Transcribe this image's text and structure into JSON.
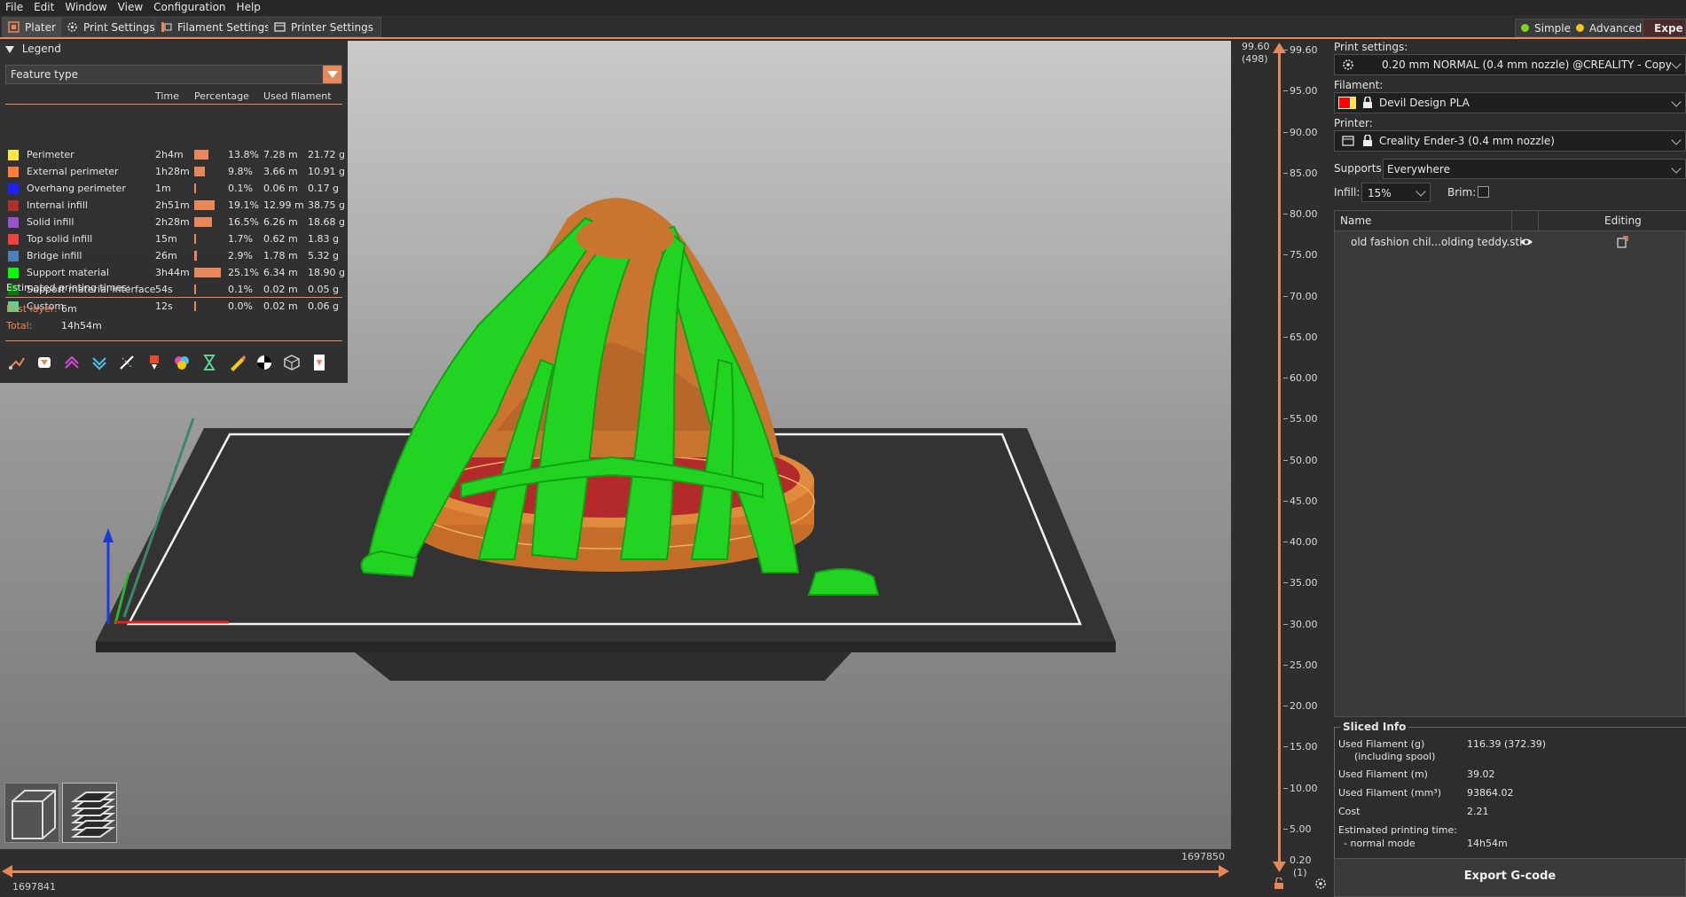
{
  "menu": [
    "File",
    "Edit",
    "Window",
    "View",
    "Configuration",
    "Help"
  ],
  "tabs": [
    "Plater",
    "Print Settings",
    "Filament Settings",
    "Printer Settings"
  ],
  "modes": [
    {
      "label": "Simple",
      "color": "#7ed321"
    },
    {
      "label": "Advanced",
      "color": "#f5c518"
    },
    {
      "label": "Expe",
      "color": "#d0021b"
    }
  ],
  "legend": {
    "title": "Legend",
    "feature_type": "Feature type",
    "columns": {
      "time": "Time",
      "percentage": "Percentage",
      "used": "Used filament"
    },
    "rows": [
      {
        "name": "Perimeter",
        "color": "#ffe640",
        "time": "2h4m",
        "pct": "13.8%",
        "pct_value": 13.8,
        "len": "7.28 m",
        "wt": "21.72 g"
      },
      {
        "name": "External perimeter",
        "color": "#ff7d38",
        "time": "1h28m",
        "pct": "9.8%",
        "pct_value": 9.8,
        "len": "3.66 m",
        "wt": "10.91 g"
      },
      {
        "name": "Overhang perimeter",
        "color": "#1f1fff",
        "time": "1m",
        "pct": "0.1%",
        "pct_value": 0.1,
        "len": "0.06 m",
        "wt": "0.17 g"
      },
      {
        "name": "Internal infill",
        "color": "#b03029",
        "time": "2h51m",
        "pct": "19.1%",
        "pct_value": 19.1,
        "len": "12.99 m",
        "wt": "38.75 g"
      },
      {
        "name": "Solid infill",
        "color": "#9654cc",
        "time": "2h28m",
        "pct": "16.5%",
        "pct_value": 16.5,
        "len": "6.26 m",
        "wt": "18.68 g"
      },
      {
        "name": "Top solid infill",
        "color": "#f04040",
        "time": "15m",
        "pct": "1.7%",
        "pct_value": 1.7,
        "len": "0.62 m",
        "wt": "1.83 g"
      },
      {
        "name": "Bridge infill",
        "color": "#4d80ba",
        "time": "26m",
        "pct": "2.9%",
        "pct_value": 2.9,
        "len": "1.78 m",
        "wt": "5.32 g"
      },
      {
        "name": "Support material",
        "color": "#00ff00",
        "time": "3h44m",
        "pct": "25.1%",
        "pct_value": 25.1,
        "len": "6.34 m",
        "wt": "18.90 g"
      },
      {
        "name": "Support material interface",
        "color": "#008000",
        "time": "54s",
        "pct": "0.1%",
        "pct_value": 0.1,
        "len": "0.02 m",
        "wt": "0.05 g"
      },
      {
        "name": "Custom",
        "color": "#5ed194",
        "time": "12s",
        "pct": "0.0%",
        "pct_value": 0.0,
        "len": "0.02 m",
        "wt": "0.06 g"
      }
    ],
    "estimated_label": "Estimated printing times:",
    "first_layer_label": "First layer:",
    "first_layer_value": "6m",
    "total_label": "Total:",
    "total_value": "14h54m"
  },
  "hslider": {
    "left_value": "1697841",
    "right_value": "1697850"
  },
  "vslider": {
    "top_value": "99.60",
    "top_layer": "(498)",
    "bottom_value": "0.20",
    "bottom_layer": "(1)",
    "ticks": [
      "99.60",
      "95.00",
      "90.00",
      "85.00",
      "80.00",
      "75.00",
      "70.00",
      "65.00",
      "60.00",
      "55.00",
      "50.00",
      "45.00",
      "40.00",
      "35.00",
      "30.00",
      "25.00",
      "20.00",
      "15.00",
      "10.00",
      "5.00"
    ]
  },
  "right": {
    "print_settings_label": "Print settings:",
    "print_settings_value": "0.20 mm NORMAL (0.4 mm nozzle) @CREALITY - Copy",
    "filament_label": "Filament:",
    "filament_value": "Devil Design PLA",
    "filament_color": "#ff0000",
    "printer_label": "Printer:",
    "printer_value": "Creality Ender-3 (0.4 mm nozzle)",
    "supports_label": "Supports:",
    "supports_value": "Everywhere",
    "infill_label": "Infill:",
    "infill_value": "15%",
    "brim_label": "Brim:",
    "list_name_col": "Name",
    "list_editing_col": "Editing",
    "object_name": "old fashion chil...olding teddy.stl"
  },
  "sliced": {
    "title": "Sliced Info",
    "used_g_label": "Used Filament (g)",
    "used_g_sub": "(including spool)",
    "used_g_value": "116.39 (372.39)",
    "used_m_label": "Used Filament (m)",
    "used_m_value": "39.02",
    "used_mm3_label": "Used Filament (mm³)",
    "used_mm3_value": "93864.02",
    "cost_label": "Cost",
    "cost_value": "2.21",
    "est_label": "Estimated printing time:",
    "normal_label": "- normal mode",
    "normal_value": "14h54m"
  },
  "export_label": "Export G-code"
}
